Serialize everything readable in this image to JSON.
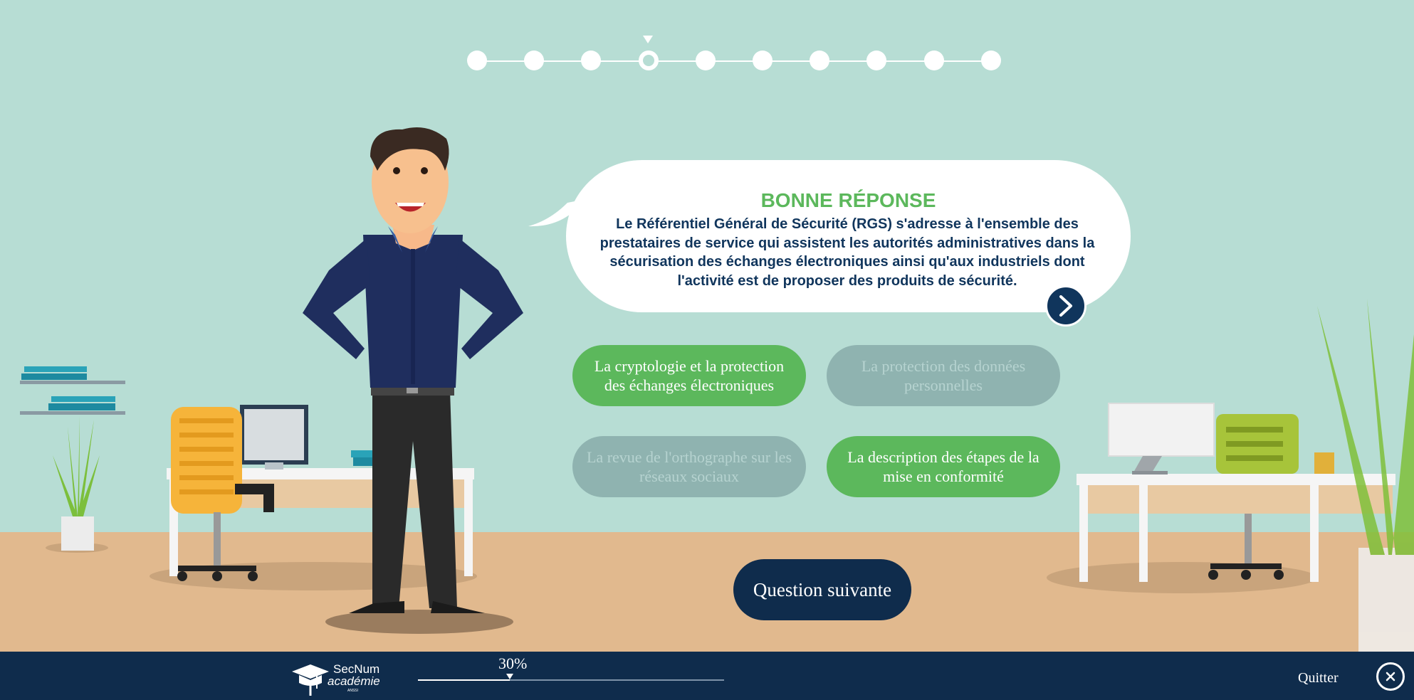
{
  "progress_steps": {
    "total": 10,
    "current": 4
  },
  "feedback": {
    "title": "BONNE RÉPONSE",
    "text": "Le Référentiel Général de Sécurité (RGS) s'adresse à l'ensemble des prestataires de service qui assistent les autorités administratives dans la sécurisation des échanges électroniques ainsi qu'aux industriels dont l'activité est de proposer des produits de sécurité."
  },
  "answers": [
    {
      "label": "La cryptologie et la protection des échanges électroniques",
      "state": "correct"
    },
    {
      "label": "La protection des données personnelles",
      "state": "disabled"
    },
    {
      "label": "La revue de l'orthographe sur les réseaux sociaux",
      "state": "disabled"
    },
    {
      "label": "La description des étapes de la mise en conformité",
      "state": "correct"
    }
  ],
  "next_question": {
    "label": "Question suivante"
  },
  "footer": {
    "logo": {
      "name": "SecNum",
      "sub": "académie",
      "tiny": "ANSSI"
    },
    "progress": {
      "label": "30%",
      "value": 0.3
    },
    "quit_label": "Quitter"
  },
  "colors": {
    "wall": "#b7ddd4",
    "floor": "#e1b98e",
    "navy": "#0f2c4c",
    "correct": "#5cb85c",
    "disabled": "#8fb3b0"
  }
}
